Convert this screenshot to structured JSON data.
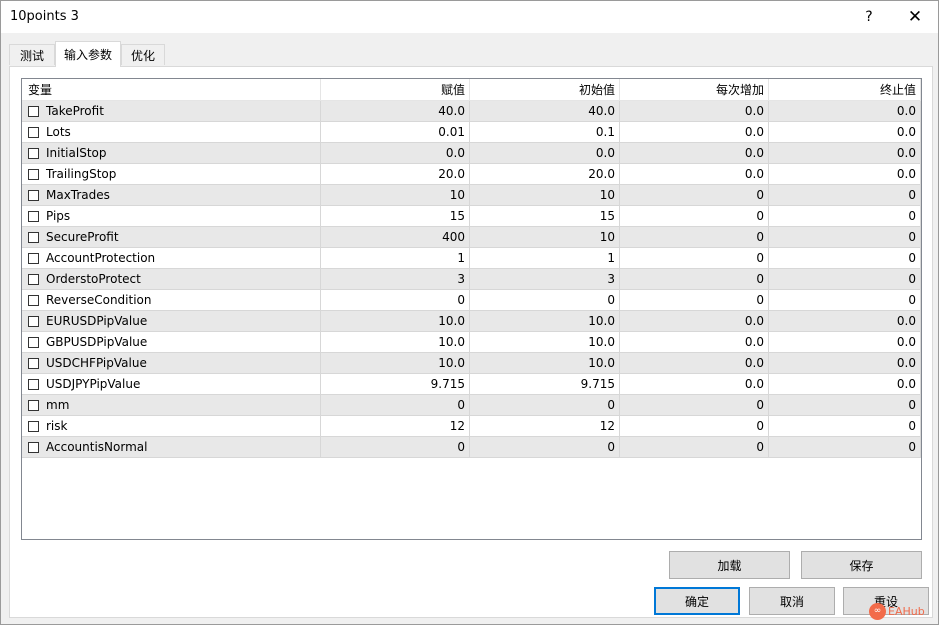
{
  "window": {
    "title": "10points 3",
    "help_label": "?",
    "close_label": "✕"
  },
  "tabs": [
    {
      "label": "测试"
    },
    {
      "label": "输入参数",
      "active": true
    },
    {
      "label": "优化"
    }
  ],
  "table": {
    "columns": [
      "变量",
      "赋值",
      "初始值",
      "每次增加",
      "终止值"
    ],
    "rows": [
      {
        "name": "TakeProfit",
        "value": "40.0",
        "start": "40.0",
        "step": "0.0",
        "stop": "0.0"
      },
      {
        "name": "Lots",
        "value": "0.01",
        "start": "0.1",
        "step": "0.0",
        "stop": "0.0"
      },
      {
        "name": "InitialStop",
        "value": "0.0",
        "start": "0.0",
        "step": "0.0",
        "stop": "0.0"
      },
      {
        "name": "TrailingStop",
        "value": "20.0",
        "start": "20.0",
        "step": "0.0",
        "stop": "0.0"
      },
      {
        "name": "MaxTrades",
        "value": "10",
        "start": "10",
        "step": "0",
        "stop": "0"
      },
      {
        "name": "Pips",
        "value": "15",
        "start": "15",
        "step": "0",
        "stop": "0"
      },
      {
        "name": "SecureProfit",
        "value": "400",
        "start": "10",
        "step": "0",
        "stop": "0"
      },
      {
        "name": "AccountProtection",
        "value": "1",
        "start": "1",
        "step": "0",
        "stop": "0"
      },
      {
        "name": "OrderstoProtect",
        "value": "3",
        "start": "3",
        "step": "0",
        "stop": "0"
      },
      {
        "name": "ReverseCondition",
        "value": "0",
        "start": "0",
        "step": "0",
        "stop": "0"
      },
      {
        "name": "EURUSDPipValue",
        "value": "10.0",
        "start": "10.0",
        "step": "0.0",
        "stop": "0.0"
      },
      {
        "name": "GBPUSDPipValue",
        "value": "10.0",
        "start": "10.0",
        "step": "0.0",
        "stop": "0.0"
      },
      {
        "name": "USDCHFPipValue",
        "value": "10.0",
        "start": "10.0",
        "step": "0.0",
        "stop": "0.0"
      },
      {
        "name": "USDJPYPipValue",
        "value": "9.715",
        "start": "9.715",
        "step": "0.0",
        "stop": "0.0"
      },
      {
        "name": "mm",
        "value": "0",
        "start": "0",
        "step": "0",
        "stop": "0"
      },
      {
        "name": "risk",
        "value": "12",
        "start": "12",
        "step": "0",
        "stop": "0"
      },
      {
        "name": "AccountisNormal",
        "value": "0",
        "start": "0",
        "step": "0",
        "stop": "0"
      }
    ]
  },
  "buttons": {
    "load": "加载",
    "save": "保存",
    "ok": "确定",
    "cancel": "取消",
    "reset": "重设"
  },
  "watermark": {
    "logo_text": "∞",
    "text": "EAHub"
  },
  "colors": {
    "focus_border": "#0078d7",
    "row_shade": "#e8e8e8",
    "watermark": "#f06a4a"
  }
}
